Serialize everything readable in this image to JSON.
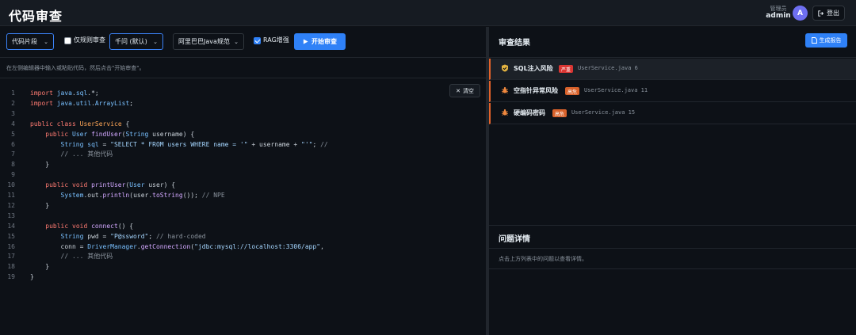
{
  "header": {
    "title": "代码审查",
    "user_role": "管理员",
    "user_name": "admin",
    "avatar_letter": "A",
    "logout_label": "登出"
  },
  "toolbar": {
    "input_mode": "代码片段",
    "rules_only_label": "仅规则审查",
    "rules_only_checked": false,
    "model": "千问 (默认)",
    "spec": "阿里巴巴Java规范",
    "rag_label": "RAG增强",
    "rag_checked": true,
    "start_label": "开始审查"
  },
  "hint": "在左侧编辑器中输入或粘贴代码，然后点击\"开始审查\"。",
  "editor": {
    "clear_label": "清空",
    "lines": [
      {
        "n": "1",
        "t": "import java.sql.*;"
      },
      {
        "n": "2",
        "t": "import java.util.ArrayList;"
      },
      {
        "n": "3",
        "t": ""
      },
      {
        "n": "4",
        "t": "public class UserService {"
      },
      {
        "n": "5",
        "t": "    public User findUser(String username) {"
      },
      {
        "n": "6",
        "t": "        String sql = \"SELECT * FROM users WHERE name = '\" + username + \"'\"; //"
      },
      {
        "n": "7",
        "t": "        // ... 其他代码"
      },
      {
        "n": "8",
        "t": "    }"
      },
      {
        "n": "9",
        "t": ""
      },
      {
        "n": "10",
        "t": "    public void printUser(User user) {"
      },
      {
        "n": "11",
        "t": "        System.out.println(user.toString()); // NPE"
      },
      {
        "n": "12",
        "t": "    }"
      },
      {
        "n": "13",
        "t": ""
      },
      {
        "n": "14",
        "t": "    public void connect() {"
      },
      {
        "n": "15",
        "t": "        String pwd = \"P@ssword\"; // hard-coded"
      },
      {
        "n": "16",
        "t": "        conn = DriverManager.getConnection(\"jdbc:mysql://localhost:3306/app\","
      },
      {
        "n": "17",
        "t": "        // ... 其他代码"
      },
      {
        "n": "18",
        "t": "    }"
      },
      {
        "n": "19",
        "t": "}"
      }
    ]
  },
  "results": {
    "title": "审查结果",
    "report_label": "生成报告",
    "issues": [
      {
        "title": "SQL注入风险",
        "severity": "严重",
        "file": "UserService.java",
        "line": "6"
      },
      {
        "title": "空指针异常风险",
        "severity": "高危",
        "file": "UserService.java",
        "line": "11"
      },
      {
        "title": "硬编码密码",
        "severity": "高危",
        "file": "UserService.java",
        "line": "15"
      }
    ]
  },
  "detail": {
    "title": "问题详情",
    "placeholder": "点击上方列表中的问题以查看详情。"
  },
  "colors": {
    "accent": "#2f81f7",
    "critical": "#da3633",
    "high": "#d9622b"
  }
}
